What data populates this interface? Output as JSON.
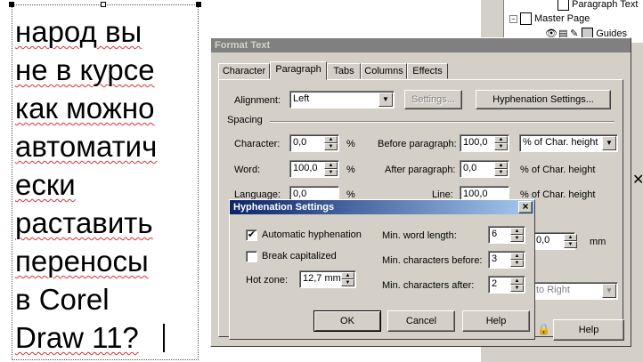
{
  "canvas_text": [
    "народ вы",
    "не в курсе",
    "как можно",
    "автоматич",
    "ески",
    "раставить",
    "переносы",
    "в Corel",
    "Draw 11?"
  ],
  "tree": {
    "item1": "Paragraph Text",
    "item2": "Master Page",
    "item3": "Guides"
  },
  "format_text": {
    "title": "Format Text",
    "tabs": [
      "Character",
      "Paragraph",
      "Tabs",
      "Columns",
      "Effects"
    ],
    "alignment_label": "Alignment:",
    "alignment_value": "Left",
    "settings_label": "Settings...",
    "hyphenation_settings_label": "Hyphenation Settings...",
    "spacing_label": "Spacing",
    "character_label": "Character:",
    "character_value": "0,0",
    "word_label": "Word:",
    "word_value": "100,0",
    "language_label": "Language:",
    "language_value": "0,0",
    "percent": "%",
    "before_paragraph_label": "Before paragraph:",
    "before_paragraph_value": "100,0",
    "before_unit": "% of Char. height",
    "after_paragraph_label": "After paragraph:",
    "after_paragraph_value": "0,0",
    "after_unit": "% of Char. height",
    "line_label": "Line:",
    "line_value": "100,0",
    "line_unit": "% of Char. height",
    "indent_value": "0,0",
    "mm": "mm",
    "direction_value": "to Right",
    "help_label": "Help"
  },
  "hyphenation": {
    "title": "Hyphenation Settings",
    "auto_label": "Automatic hyphenation",
    "auto_checked": true,
    "break_label": "Break capitalized",
    "break_checked": false,
    "hot_zone_label": "Hot zone:",
    "hot_zone_value": "12,7 mm",
    "min_word_label": "Min. word length:",
    "min_word_value": "6",
    "min_before_label": "Min. characters before:",
    "min_before_value": "3",
    "min_after_label": "Min. characters after:",
    "min_after_value": "2",
    "ok_label": "OK",
    "cancel_label": "Cancel",
    "help_label": "Help",
    "close_glyph": "×"
  }
}
